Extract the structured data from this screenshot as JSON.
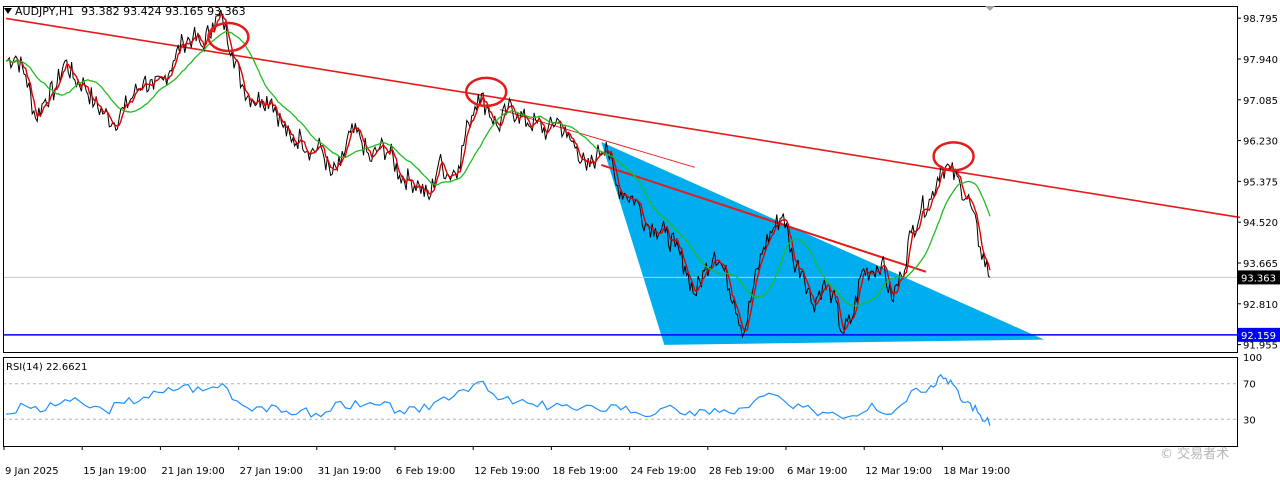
{
  "header": {
    "symbol": "AUDJPY,H1",
    "values": "93.382 93.424 93.165 93.363"
  },
  "rsi_panel": {
    "label": "RSI(14) 22.6621"
  },
  "watermark": "© 交易者术",
  "colors": {
    "background": "#ffffff",
    "price": "#000000",
    "ma_fast": "#e00000",
    "ma_slow": "#22bb22",
    "trendline": "#e51a1a",
    "support": "#0000ff",
    "triangle": "#00aeef",
    "rsi": "#1e90ff"
  },
  "chart_data": [
    {
      "type": "line",
      "title": "AUDJPY,H1",
      "y_ticks": [
        "98.795",
        "97.940",
        "97.085",
        "96.230",
        "95.375",
        "94.520",
        "93.665",
        "92.810",
        "91.955"
      ],
      "x_ticks": [
        "9 Jan 2025",
        "15 Jan 19:00",
        "21 Jan 19:00",
        "27 Jan 19:00",
        "31 Jan 19:00",
        "6 Feb 19:00",
        "12 Feb 19:00",
        "18 Feb 19:00",
        "24 Feb 19:00",
        "28 Feb 19:00",
        "6 Mar 19:00",
        "12 Mar 19:00",
        "18 Mar 19:00"
      ],
      "ylim": [
        91.8,
        99.05
      ],
      "x_index_range": [
        0,
        100
      ],
      "current_price": "93.363",
      "support_level": "92.159",
      "series": [
        {
          "values": [
            [
              0,
              97.9
            ],
            [
              1,
              98.0
            ],
            [
              2,
              97.6
            ],
            [
              3,
              96.7
            ],
            [
              4,
              97.1
            ],
            [
              5,
              97.3
            ],
            [
              6,
              97.9
            ],
            [
              7,
              97.5
            ],
            [
              8,
              97.4
            ],
            [
              9,
              97.0
            ],
            [
              10,
              96.8
            ],
            [
              11,
              96.6
            ],
            [
              12,
              96.9
            ],
            [
              13,
              97.2
            ],
            [
              14,
              97.5
            ],
            [
              15,
              97.3
            ],
            [
              16,
              97.5
            ],
            [
              17,
              97.9
            ],
            [
              18,
              98.3
            ],
            [
              19,
              98.4
            ],
            [
              20,
              98.2
            ],
            [
              21,
              98.7
            ],
            [
              22,
              98.8
            ],
            [
              23,
              98.1
            ],
            [
              24,
              97.4
            ],
            [
              25,
              97.1
            ],
            [
              26,
              97.1
            ],
            [
              27,
              97.1
            ],
            [
              28,
              96.6
            ],
            [
              29,
              96.2
            ],
            [
              30,
              96.3
            ],
            [
              31,
              96.0
            ],
            [
              32,
              96.1
            ],
            [
              33,
              95.5
            ],
            [
              34,
              95.7
            ],
            [
              35,
              96.4
            ],
            [
              36,
              96.3
            ],
            [
              37,
              95.8
            ],
            [
              38,
              96.1
            ],
            [
              39,
              96.0
            ],
            [
              40,
              95.5
            ],
            [
              41,
              95.4
            ],
            [
              42,
              95.3
            ],
            [
              43,
              95.0
            ],
            [
              44,
              95.8
            ],
            [
              45,
              95.5
            ],
            [
              46,
              95.7
            ],
            [
              47,
              96.6
            ],
            [
              48,
              97.2
            ],
            [
              49,
              96.9
            ],
            [
              50,
              96.5
            ],
            [
              51,
              96.9
            ],
            [
              52,
              96.8
            ],
            [
              53,
              96.6
            ],
            [
              54,
              96.6
            ],
            [
              55,
              96.4
            ],
            [
              56,
              96.7
            ],
            [
              57,
              96.3
            ],
            [
              58,
              96.1
            ],
            [
              59,
              95.6
            ],
            [
              60,
              95.9
            ],
            [
              61,
              96.2
            ],
            [
              62,
              95.3
            ],
            [
              63,
              95.1
            ],
            [
              64,
              95.0
            ],
            [
              65,
              94.5
            ],
            [
              66,
              94.4
            ],
            [
              67,
              94.3
            ],
            [
              68,
              94.0
            ],
            [
              69,
              93.6
            ],
            [
              70,
              93.0
            ],
            [
              71,
              93.5
            ],
            [
              72,
              93.9
            ],
            [
              73,
              93.5
            ],
            [
              74,
              92.9
            ],
            [
              75,
              92.2
            ],
            [
              76,
              93.2
            ],
            [
              77,
              94.0
            ],
            [
              78,
              94.4
            ],
            [
              79,
              94.7
            ],
            [
              80,
              93.7
            ],
            [
              81,
              93.5
            ],
            [
              82,
              92.8
            ],
            [
              83,
              93.2
            ],
            [
              84,
              93.0
            ],
            [
              85,
              92.2
            ],
            [
              86,
              92.5
            ],
            [
              87,
              93.5
            ],
            [
              88,
              93.5
            ],
            [
              89,
              93.7
            ],
            [
              90,
              92.9
            ],
            [
              91,
              93.4
            ],
            [
              92,
              94.3
            ],
            [
              93,
              94.8
            ],
            [
              94,
              95.0
            ],
            [
              95,
              95.7
            ],
            [
              96,
              95.6
            ],
            [
              97,
              95.3
            ],
            [
              98,
              94.9
            ],
            [
              99,
              94.0
            ],
            [
              100,
              93.363
            ]
          ]
        }
      ]
    },
    {
      "type": "line",
      "title": "RSI(14) 22.6621",
      "y_ticks": [
        "100",
        "70",
        "30",
        "0"
      ],
      "ylim": [
        0,
        100
      ],
      "series": [
        {
          "values": [
            [
              0,
              36
            ],
            [
              2,
              45
            ],
            [
              4,
              40
            ],
            [
              6,
              52
            ],
            [
              8,
              46
            ],
            [
              10,
              40
            ],
            [
              12,
              48
            ],
            [
              14,
              55
            ],
            [
              16,
              60
            ],
            [
              18,
              68
            ],
            [
              20,
              62
            ],
            [
              22,
              70
            ],
            [
              24,
              46
            ],
            [
              26,
              44
            ],
            [
              28,
              38
            ],
            [
              30,
              40
            ],
            [
              32,
              33
            ],
            [
              34,
              50
            ],
            [
              36,
              44
            ],
            [
              38,
              46
            ],
            [
              40,
              40
            ],
            [
              42,
              38
            ],
            [
              44,
              52
            ],
            [
              46,
              62
            ],
            [
              48,
              72
            ],
            [
              50,
              52
            ],
            [
              52,
              50
            ],
            [
              54,
              44
            ],
            [
              56,
              48
            ],
            [
              58,
              40
            ],
            [
              60,
              42
            ],
            [
              62,
              46
            ],
            [
              64,
              38
            ],
            [
              66,
              36
            ],
            [
              68,
              42
            ],
            [
              70,
              34
            ],
            [
              72,
              42
            ],
            [
              74,
              36
            ],
            [
              76,
              50
            ],
            [
              78,
              58
            ],
            [
              80,
              42
            ],
            [
              82,
              40
            ],
            [
              84,
              38
            ],
            [
              86,
              34
            ],
            [
              88,
              48
            ],
            [
              90,
              36
            ],
            [
              92,
              62
            ],
            [
              94,
              68
            ],
            [
              95,
              80
            ],
            [
              96,
              74
            ],
            [
              97,
              52
            ],
            [
              98,
              48
            ],
            [
              99,
              35
            ],
            [
              100,
              22.66
            ]
          ]
        }
      ]
    }
  ]
}
